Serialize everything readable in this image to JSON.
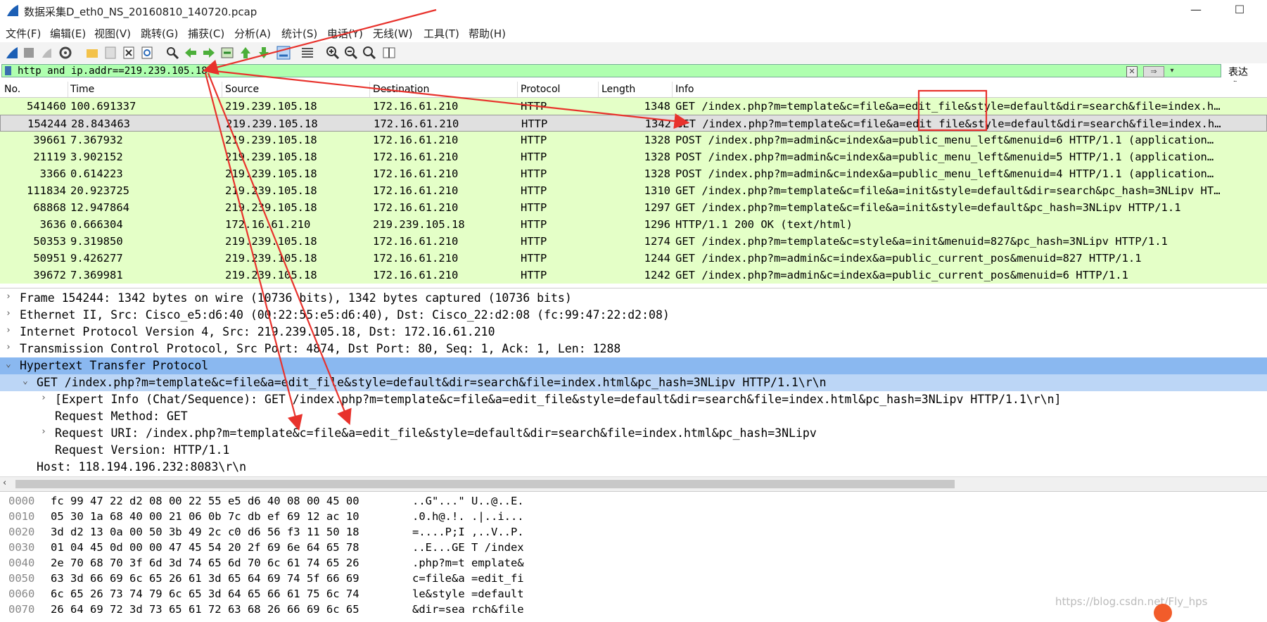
{
  "window": {
    "title": "数据采集D_eth0_NS_20160810_140720.pcap",
    "minimize": "—",
    "maximize": "☐"
  },
  "menu": [
    "文件(F)",
    "编辑(E)",
    "视图(V)",
    "跳转(G)",
    "捕获(C)",
    "分析(A)",
    "统计(S)",
    "电话(Y)",
    "无线(W)",
    "工具(T)",
    "帮助(H)"
  ],
  "toolbar_icons": [
    "shark-fin-start-icon",
    "stop-icon",
    "restart-icon",
    "options-gear-icon",
    "open-folder-icon",
    "save-icon",
    "close-file-icon",
    "reload-icon",
    "find-icon",
    "go-back-icon",
    "go-forward-icon",
    "go-to-packet-icon",
    "first-packet-icon",
    "last-packet-icon",
    "autoscroll-icon",
    "colorize-icon",
    "zoom-in-icon",
    "zoom-out-icon",
    "zoom-normal-icon",
    "resize-columns-icon"
  ],
  "filter": {
    "value": "http and ip.addr==219.239.105.18",
    "clear": "✕",
    "apply": "⇒",
    "dropdown": "▾",
    "expression_label": "表达式…"
  },
  "columns": [
    "No.",
    "Time",
    "Source",
    "Destination",
    "Protocol",
    "Length",
    "Info"
  ],
  "packets": [
    {
      "no": "541460",
      "time": "100.691337",
      "src": "219.239.105.18",
      "dst": "172.16.61.210",
      "proto": "HTTP",
      "len": "1348",
      "info": "GET /index.php?m=template&c=file&a=edit_file&style=default&dir=search&file=index.h…"
    },
    {
      "no": "154244",
      "time": "28.843463",
      "src": "219.239.105.18",
      "dst": "172.16.61.210",
      "proto": "HTTP",
      "len": "1342",
      "info": "GET /index.php?m=template&c=file&a=edit_file&style=default&dir=search&file=index.h…"
    },
    {
      "no": "39661",
      "time": "7.367932",
      "src": "219.239.105.18",
      "dst": "172.16.61.210",
      "proto": "HTTP",
      "len": "1328",
      "info": "POST /index.php?m=admin&c=index&a=public_menu_left&menuid=6 HTTP/1.1  (application…"
    },
    {
      "no": "21119",
      "time": "3.902152",
      "src": "219.239.105.18",
      "dst": "172.16.61.210",
      "proto": "HTTP",
      "len": "1328",
      "info": "POST /index.php?m=admin&c=index&a=public_menu_left&menuid=5 HTTP/1.1  (application…"
    },
    {
      "no": "3366",
      "time": "0.614223",
      "src": "219.239.105.18",
      "dst": "172.16.61.210",
      "proto": "HTTP",
      "len": "1328",
      "info": "POST /index.php?m=admin&c=index&a=public_menu_left&menuid=4 HTTP/1.1  (application…"
    },
    {
      "no": "111834",
      "time": "20.923725",
      "src": "219.239.105.18",
      "dst": "172.16.61.210",
      "proto": "HTTP",
      "len": "1310",
      "info": "GET /index.php?m=template&c=file&a=init&style=default&dir=search&pc_hash=3NLipv HT…"
    },
    {
      "no": "68868",
      "time": "12.947864",
      "src": "219.239.105.18",
      "dst": "172.16.61.210",
      "proto": "HTTP",
      "len": "1297",
      "info": "GET /index.php?m=template&c=file&a=init&style=default&pc_hash=3NLipv HTTP/1.1"
    },
    {
      "no": "3636",
      "time": "0.666304",
      "src": "172.16.61.210",
      "dst": "219.239.105.18",
      "proto": "HTTP",
      "len": "1296",
      "info": "HTTP/1.1 200 OK  (text/html)"
    },
    {
      "no": "50353",
      "time": "9.319850",
      "src": "219.239.105.18",
      "dst": "172.16.61.210",
      "proto": "HTTP",
      "len": "1274",
      "info": "GET /index.php?m=template&c=style&a=init&menuid=827&pc_hash=3NLipv HTTP/1.1"
    },
    {
      "no": "50951",
      "time": "9.426277",
      "src": "219.239.105.18",
      "dst": "172.16.61.210",
      "proto": "HTTP",
      "len": "1244",
      "info": "GET /index.php?m=admin&c=index&a=public_current_pos&menuid=827 HTTP/1.1"
    },
    {
      "no": "39672",
      "time": "7.369981",
      "src": "219.239.105.18",
      "dst": "172.16.61.210",
      "proto": "HTTP",
      "len": "1242",
      "info": "GET /index.php?m=admin&c=index&a=public_current_pos&menuid=6 HTTP/1.1"
    }
  ],
  "details": [
    {
      "arrow": "›",
      "indent": 0,
      "text": "Frame 154244: 1342 bytes on wire (10736 bits), 1342 bytes captured (10736 bits)"
    },
    {
      "arrow": "›",
      "indent": 0,
      "text": "Ethernet II, Src: Cisco_e5:d6:40 (00:22:55:e5:d6:40), Dst: Cisco_22:d2:08 (fc:99:47:22:d2:08)"
    },
    {
      "arrow": "›",
      "indent": 0,
      "text": "Internet Protocol Version 4, Src: 219.239.105.18, Dst: 172.16.61.210"
    },
    {
      "arrow": "›",
      "indent": 0,
      "text": "Transmission Control Protocol, Src Port: 4874, Dst Port: 80, Seq: 1, Ack: 1, Len: 1288"
    },
    {
      "arrow": "⌄",
      "indent": 0,
      "text": "Hypertext Transfer Protocol"
    },
    {
      "arrow": "⌄",
      "indent": 1,
      "text": "GET /index.php?m=template&c=file&a=edit_file&style=default&dir=search&file=index.html&pc_hash=3NLipv HTTP/1.1\\r\\n"
    },
    {
      "arrow": "›",
      "indent": 2,
      "text": "[Expert Info (Chat/Sequence): GET /index.php?m=template&c=file&a=edit_file&style=default&dir=search&file=index.html&pc_hash=3NLipv HTTP/1.1\\r\\n]"
    },
    {
      "arrow": "",
      "indent": 2,
      "text": "Request Method: GET"
    },
    {
      "arrow": "›",
      "indent": 2,
      "text": "Request URI: /index.php?m=template&c=file&a=edit_file&style=default&dir=search&file=index.html&pc_hash=3NLipv"
    },
    {
      "arrow": "",
      "indent": 2,
      "text": "Request Version: HTTP/1.1"
    },
    {
      "arrow": "",
      "indent": 1,
      "text": "Host: 118.194.196.232:8083\\r\\n"
    }
  ],
  "hscroll_left": "‹",
  "hex": [
    {
      "off": "0000",
      "bytes": "fc 99 47 22 d2 08 00 22  55 e5 d6 40 08 00 45 00",
      "ascii": "..G\"...\" U..@..E."
    },
    {
      "off": "0010",
      "bytes": "05 30 1a 68 40 00 21 06  0b 7c db ef 69 12 ac 10",
      "ascii": ".0.h@.!. .|..i..."
    },
    {
      "off": "0020",
      "bytes": "3d d2 13 0a 00 50 3b 49  2c c0 d6 56 f3 11 50 18",
      "ascii": "=....P;I ,..V..P."
    },
    {
      "off": "0030",
      "bytes": "01 04 45 0d 00 00 47 45  54 20 2f 69 6e 64 65 78",
      "ascii": "..E...GE T /index"
    },
    {
      "off": "0040",
      "bytes": "2e 70 68 70 3f 6d 3d 74  65 6d 70 6c 61 74 65 26",
      "ascii": ".php?m=t emplate&"
    },
    {
      "off": "0050",
      "bytes": "63 3d 66 69 6c 65 26 61  3d 65 64 69 74 5f 66 69",
      "ascii": "c=file&a =edit_fi"
    },
    {
      "off": "0060",
      "bytes": "6c 65 26 73 74 79 6c 65  3d 64 65 66 61 75 6c 74",
      "ascii": "le&style =default"
    },
    {
      "off": "0070",
      "bytes": "26 64 69 72 3d 73 65 61  72 63 68 26 66 69 6c 65",
      "ascii": "&dir=sea rch&file"
    }
  ],
  "watermark": "https://blog.csdn.net/Fly_hps",
  "colors": {
    "row_green": "#e4ffc7",
    "selected_detail": "#8ab8f0",
    "annotation_red": "#e8322c",
    "filter_green": "#afffaf"
  }
}
